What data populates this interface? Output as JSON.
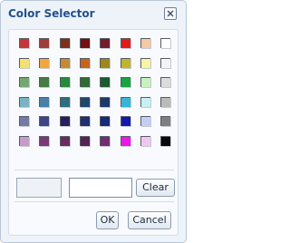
{
  "dialog": {
    "title": "Color Selector",
    "close_icon": "close-x-icon"
  },
  "palette": {
    "rows": [
      [
        "#c2383a",
        "#a03c3c",
        "#7f3018",
        "#741010",
        "#741d2b",
        "#e01b1b",
        "#f4c9a4",
        "#ffffff"
      ],
      [
        "#f3e270",
        "#f3a63d",
        "#c88a31",
        "#c66417",
        "#9e8817",
        "#c0b52d",
        "#f8f4a6",
        "#f4f4f4"
      ],
      [
        "#74a870",
        "#467a47",
        "#278a3a",
        "#306b35",
        "#1a5c31",
        "#19a43f",
        "#c9f2c0",
        "#dcdcdc"
      ],
      [
        "#7ab3c2",
        "#4a7fa8",
        "#2d6e80",
        "#20486b",
        "#1d3a6a",
        "#38b4d6",
        "#c7f0f5",
        "#bababa"
      ],
      [
        "#7479a6",
        "#3c4588",
        "#28205e",
        "#1f2f72",
        "#152a78",
        "#1518ad",
        "#c6cdf5",
        "#7f7f7f"
      ],
      [
        "#c49bcb",
        "#7a3a78",
        "#6a2a60",
        "#562253",
        "#742b74",
        "#ee16e6",
        "#f1c7f2",
        "#0a0a0a"
      ]
    ]
  },
  "custom": {
    "hex_value": "",
    "hex_placeholder": "",
    "preview_color": "#eef1f6"
  },
  "buttons": {
    "clear": "Clear",
    "ok": "OK",
    "cancel": "Cancel"
  }
}
